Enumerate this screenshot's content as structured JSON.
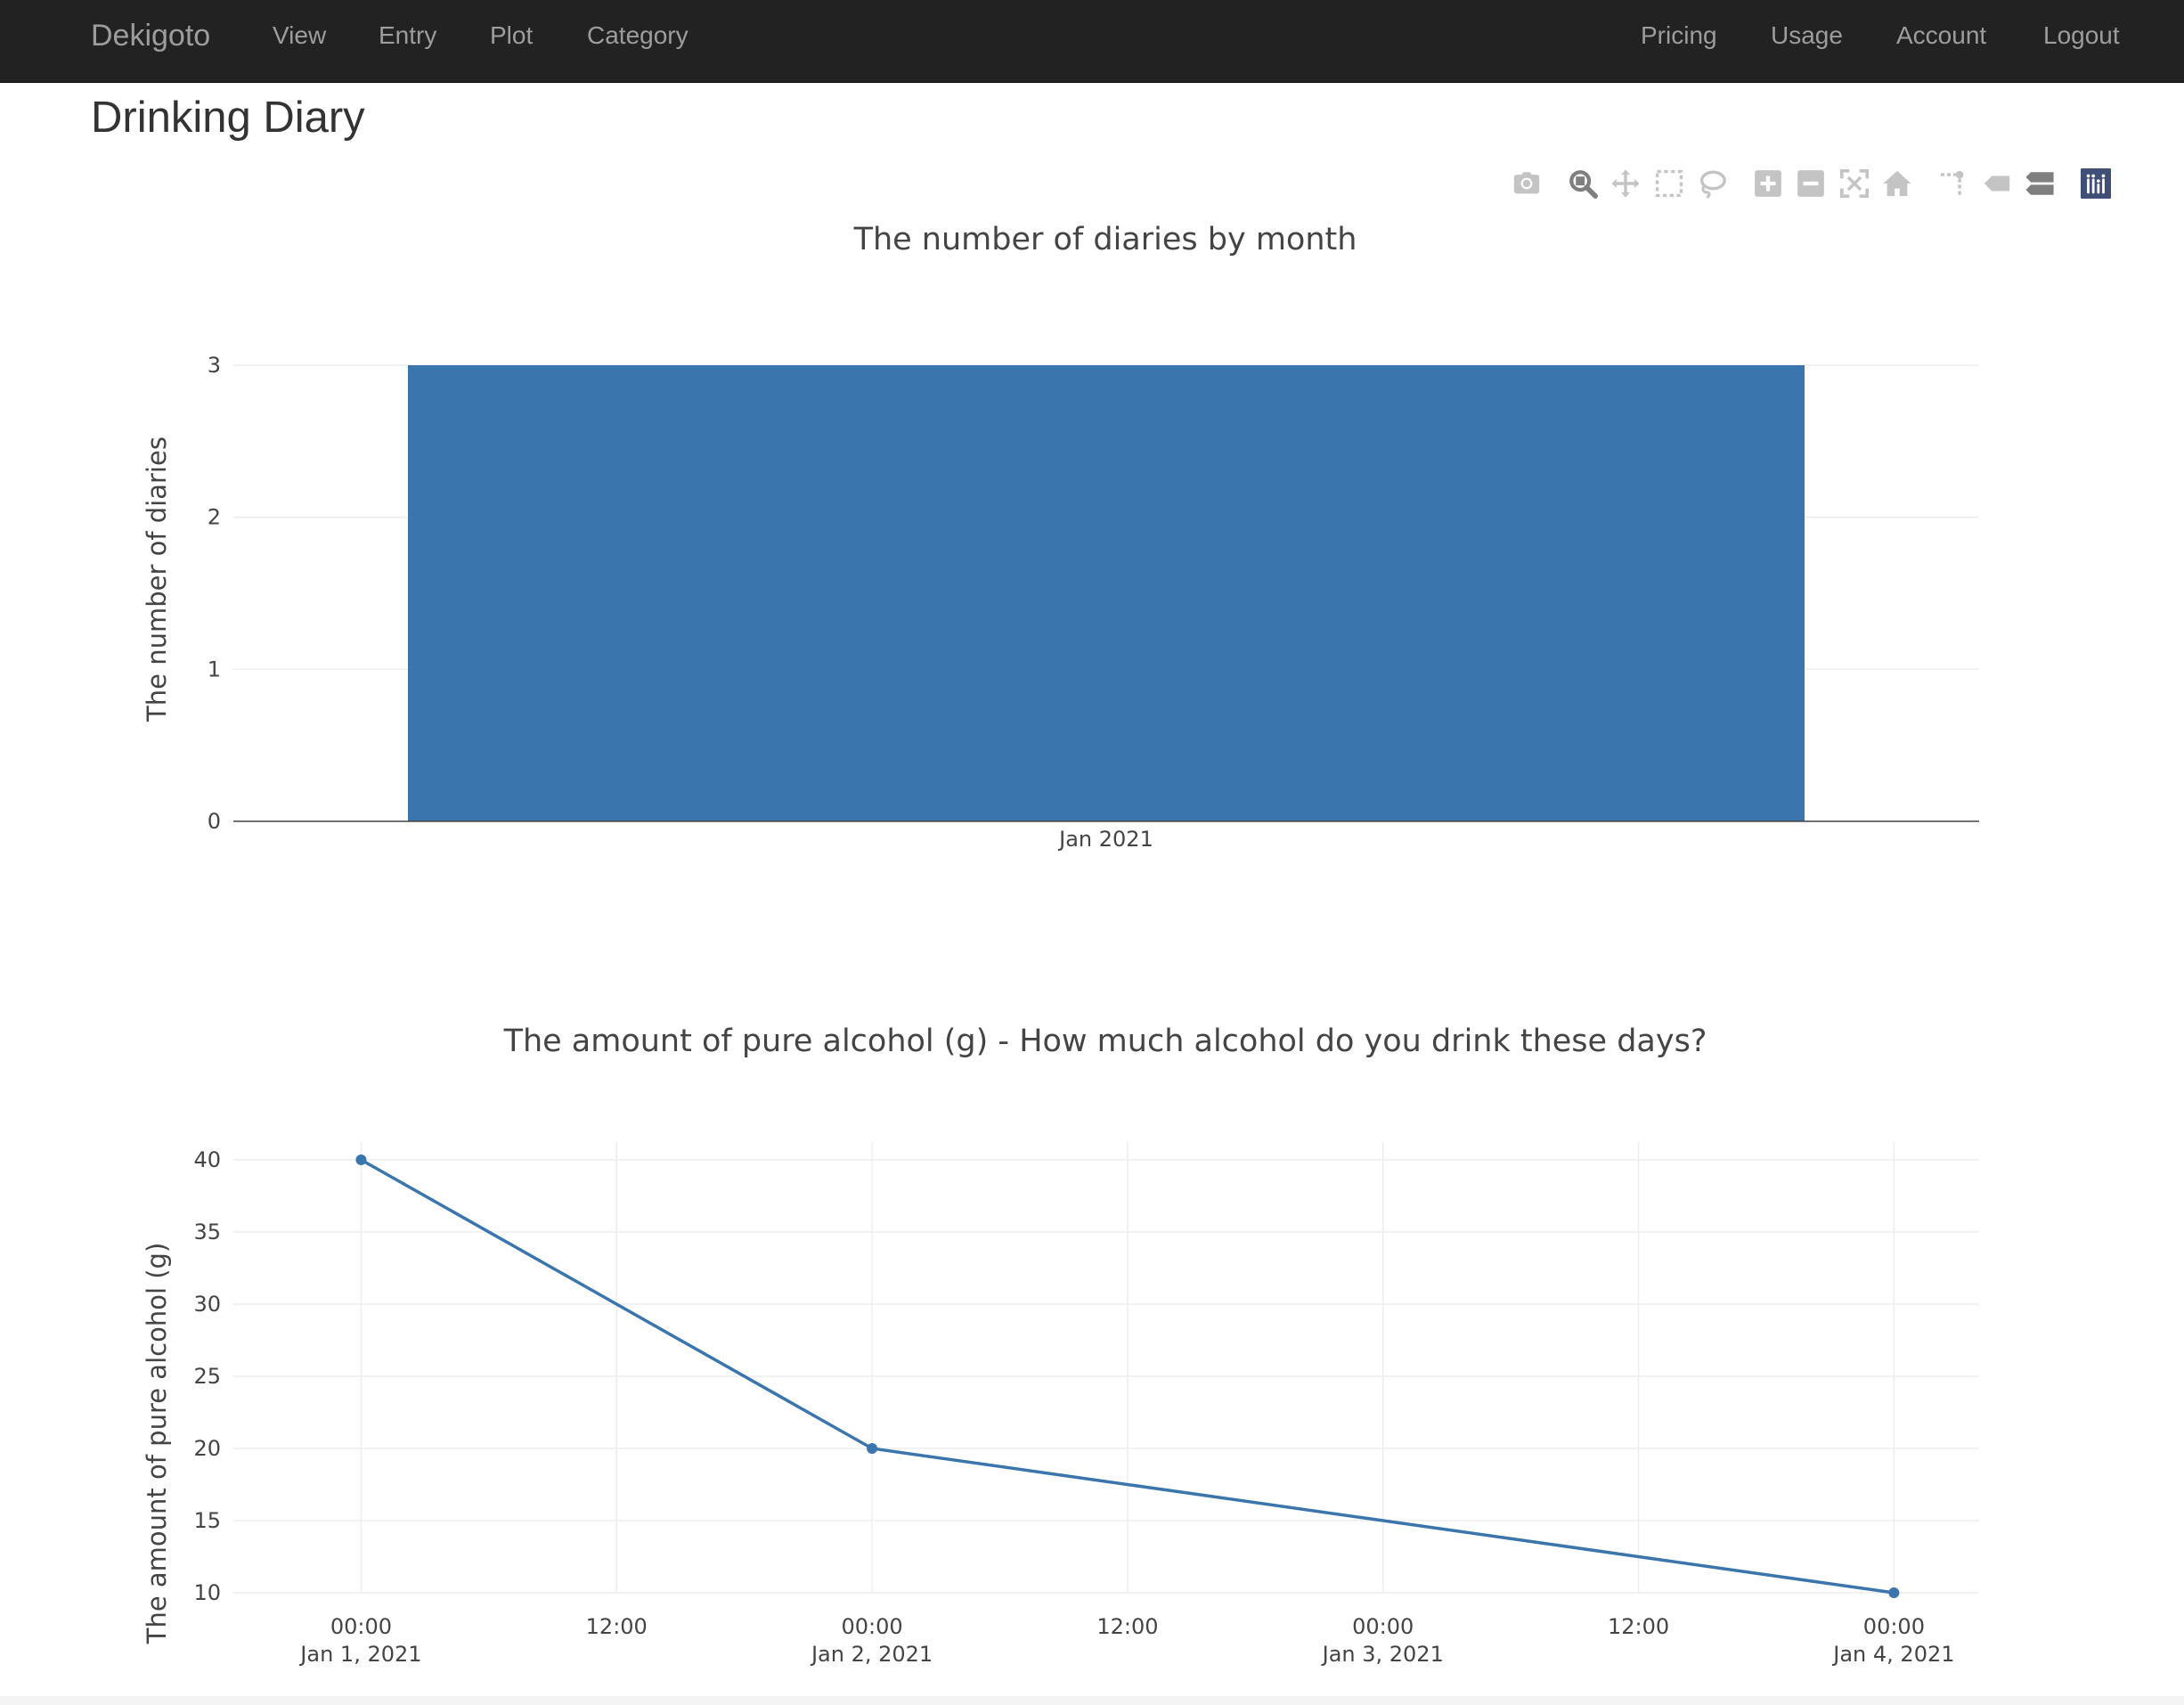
{
  "navbar": {
    "brand": "Dekigoto",
    "left_items": [
      {
        "label": "View"
      },
      {
        "label": "Entry"
      },
      {
        "label": "Plot"
      },
      {
        "label": "Category"
      }
    ],
    "right_items": [
      {
        "label": "Pricing"
      },
      {
        "label": "Usage"
      },
      {
        "label": "Account"
      },
      {
        "label": "Logout"
      }
    ]
  },
  "page": {
    "title": "Drinking Diary"
  },
  "modebar": {
    "buttons": [
      {
        "icon": "camera-icon"
      },
      {
        "icon": "zoom-icon"
      },
      {
        "icon": "pan-icon"
      },
      {
        "icon": "box-select-icon"
      },
      {
        "icon": "lasso-icon"
      },
      {
        "icon": "zoom-in-icon"
      },
      {
        "icon": "zoom-out-icon"
      },
      {
        "icon": "autoscale-icon"
      },
      {
        "icon": "reset-axes-icon"
      },
      {
        "icon": "spike-lines-icon"
      },
      {
        "icon": "hover-closest-icon"
      },
      {
        "icon": "hover-compare-icon"
      },
      {
        "icon": "plotly-logo-icon"
      }
    ]
  },
  "colors": {
    "navbar_bg": "#222222",
    "nav_text": "#9d9d9d",
    "series": "#3a75ad",
    "grid": "#eeeeee",
    "modebar_icon": "#c4c4c4",
    "modebar_active": "#7f7f7f",
    "plotly_logo": "#3f4f75"
  },
  "chart_data": [
    {
      "type": "bar",
      "title": "The number of diaries by month",
      "xlabel": "",
      "ylabel": "The number of diaries",
      "categories": [
        "Jan 2021"
      ],
      "values": [
        3
      ],
      "ylim": [
        0,
        3
      ],
      "yticks": [
        "0",
        "1",
        "2",
        "3"
      ],
      "grid": true,
      "legend": "none"
    },
    {
      "type": "line",
      "title": "The amount of pure alcohol (g) - How much alcohol do you drink these days?",
      "xlabel": "",
      "ylabel": "The amount of pure alcohol (g)",
      "x": [
        "2021-01-01 00:00",
        "2021-01-02 00:00",
        "2021-01-04 00:00"
      ],
      "values": [
        40,
        20,
        10
      ],
      "xlim": [
        "2020-12-31 18:00",
        "2021-01-04 04:00"
      ],
      "ylim": [
        10,
        40
      ],
      "yticks": [
        "10",
        "15",
        "20",
        "25",
        "30",
        "35",
        "40"
      ],
      "xticks": [
        {
          "time": "00:00",
          "date": "Jan 1, 2021"
        },
        {
          "time": "12:00",
          "date": ""
        },
        {
          "time": "00:00",
          "date": "Jan 2, 2021"
        },
        {
          "time": "12:00",
          "date": ""
        },
        {
          "time": "00:00",
          "date": "Jan 3, 2021"
        },
        {
          "time": "12:00",
          "date": ""
        },
        {
          "time": "00:00",
          "date": "Jan 4, 2021"
        }
      ],
      "markers": true,
      "grid": true,
      "legend": "none"
    }
  ]
}
